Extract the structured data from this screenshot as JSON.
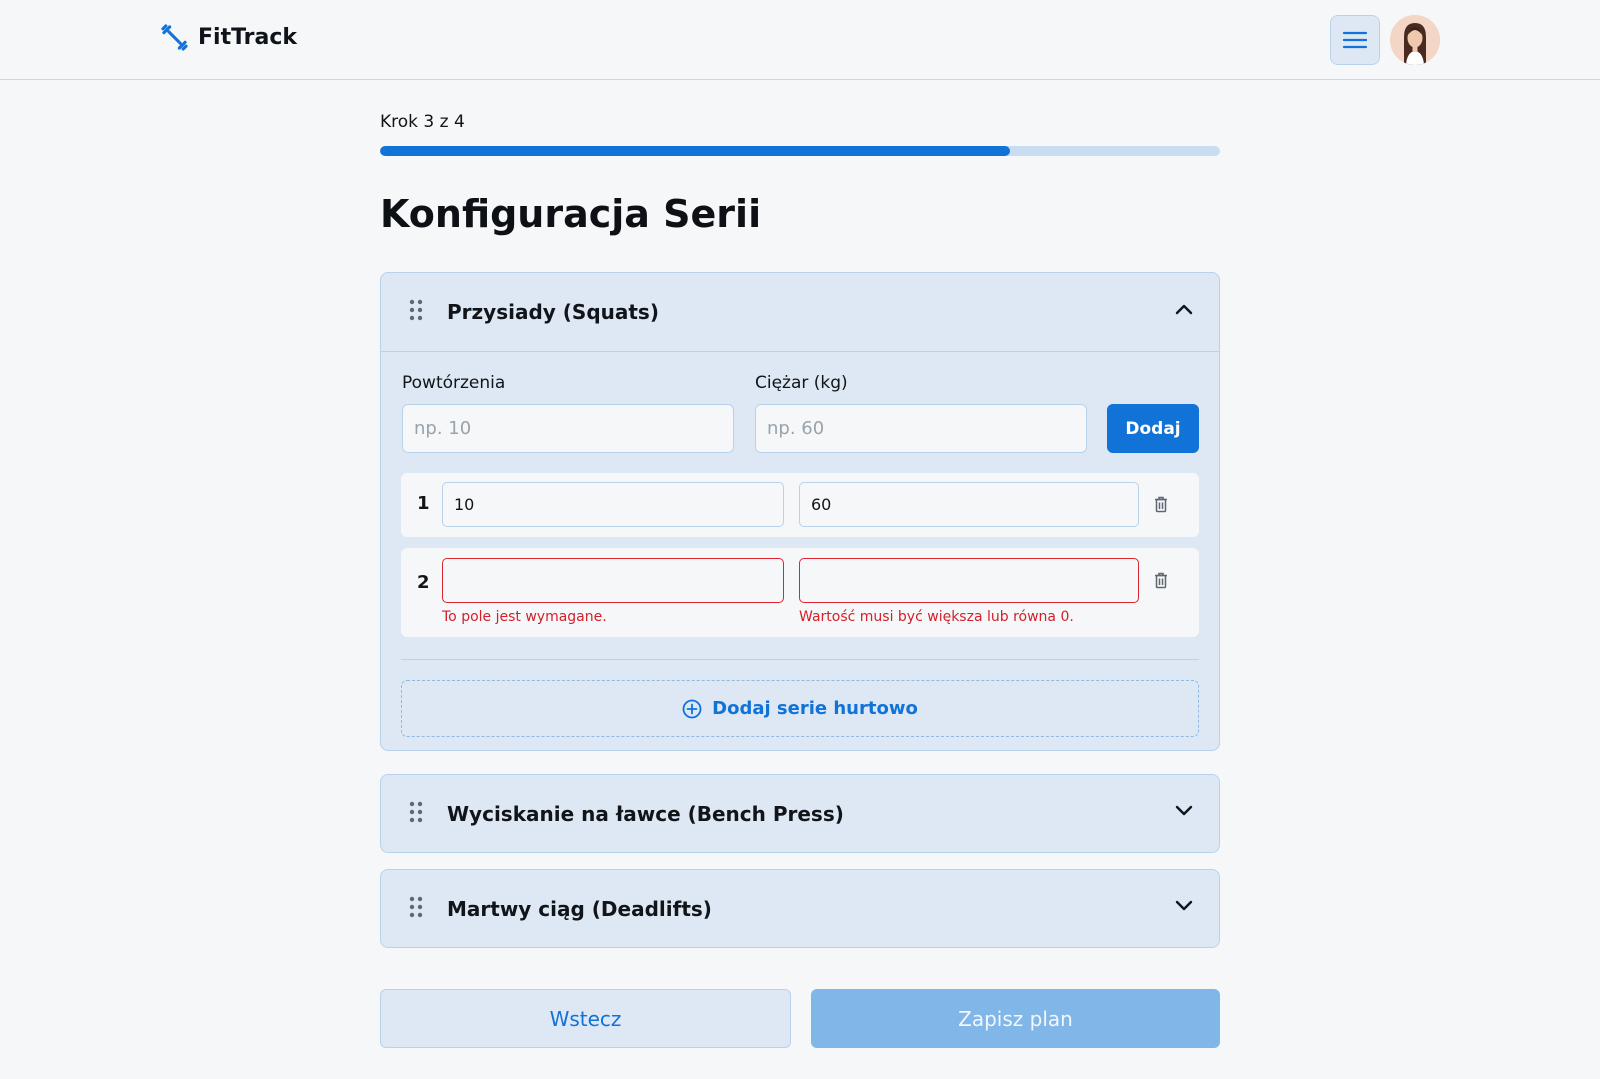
{
  "app": {
    "name": "FitTrack"
  },
  "header": {
    "menu_icon": "hamburger-icon",
    "avatar": "user-avatar"
  },
  "wizard": {
    "step_label": "Krok 3 z 4",
    "step_current": 3,
    "step_total": 4,
    "progress_percent": 75,
    "title": "Konfiguracja Serii"
  },
  "exercises": [
    {
      "name": "Przysiady (Squats)",
      "expanded": true,
      "form": {
        "reps_label": "Powtórzenia",
        "reps_placeholder": "np. 10",
        "weight_label": "Ciężar (kg)",
        "weight_placeholder": "np. 60",
        "add_label": "Dodaj"
      },
      "sets": [
        {
          "number": "1",
          "reps": "10",
          "weight": "60",
          "reps_error": "",
          "weight_error": ""
        },
        {
          "number": "2",
          "reps": "",
          "weight": "",
          "reps_error": "To pole jest wymagane.",
          "weight_error": "Wartość musi być większa lub równa 0."
        }
      ],
      "bulk_label": "Dodaj serie hurtowo"
    },
    {
      "name": "Wyciskanie na ławce (Bench Press)",
      "expanded": false
    },
    {
      "name": "Martwy ciąg (Deadlifts)",
      "expanded": false
    }
  ],
  "footer": {
    "back_label": "Wstecz",
    "save_label": "Zapisz plan"
  },
  "colors": {
    "primary": "#1172d7",
    "error": "#e0242f",
    "card_bg": "#dde8f4",
    "page_bg": "#f5f7f9"
  }
}
